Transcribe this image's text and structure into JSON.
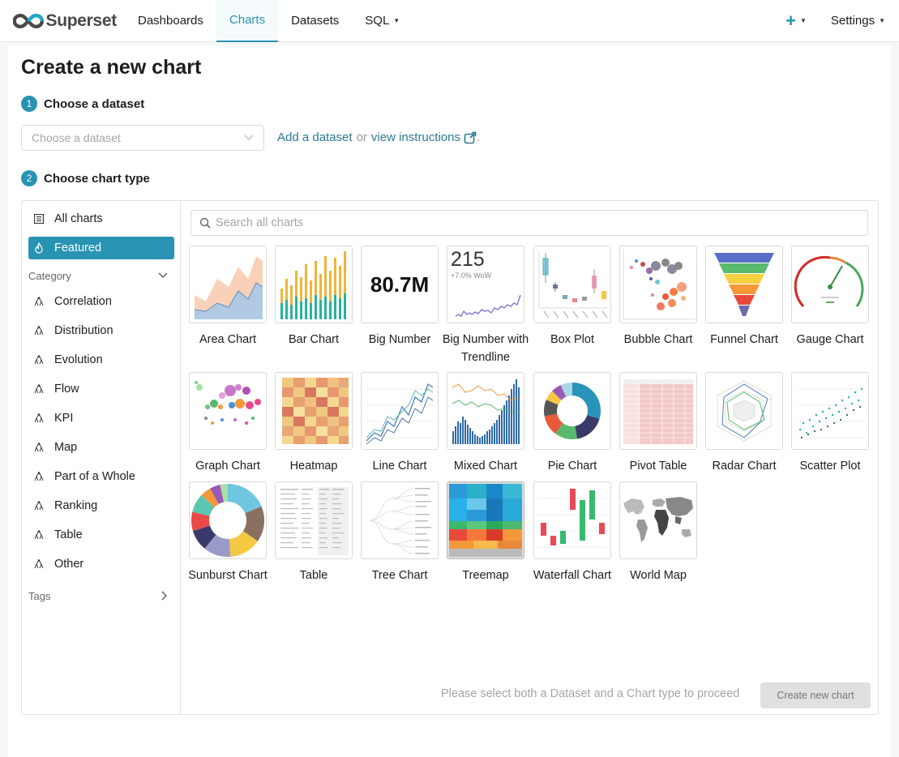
{
  "brand": {
    "name": "Superset",
    "color": "#484848",
    "accent": "#2893b3"
  },
  "nav": {
    "items": [
      {
        "label": "Dashboards"
      },
      {
        "label": "Charts"
      },
      {
        "label": "Datasets"
      },
      {
        "label": "SQL"
      }
    ],
    "active": "Charts",
    "plus_icon": "plus-icon",
    "settings_label": "Settings"
  },
  "page": {
    "title": "Create a new chart"
  },
  "steps": {
    "dataset": {
      "number": "1",
      "label": "Choose a dataset"
    },
    "chart_type": {
      "number": "2",
      "label": "Choose chart type"
    }
  },
  "dataset_select": {
    "placeholder": "Choose a dataset",
    "add_link": "Add a dataset",
    "or_text": "or",
    "instructions_link": "view instructions",
    "period": "."
  },
  "sidebar": {
    "all_charts": "All charts",
    "featured": "Featured",
    "category_header": "Category",
    "categories": [
      "Correlation",
      "Distribution",
      "Evolution",
      "Flow",
      "KPI",
      "Map",
      "Part of a Whole",
      "Ranking",
      "Table",
      "Other"
    ],
    "tags_header": "Tags"
  },
  "search": {
    "placeholder": "Search all charts"
  },
  "charts": [
    {
      "name": "Area Chart"
    },
    {
      "name": "Bar Chart"
    },
    {
      "name": "Big Number",
      "thumb_text": "80.7M"
    },
    {
      "name": "Big Number with Trendline",
      "thumb_value": "215",
      "thumb_sub": "+7.0% WoW"
    },
    {
      "name": "Box Plot"
    },
    {
      "name": "Bubble Chart"
    },
    {
      "name": "Funnel Chart"
    },
    {
      "name": "Gauge Chart"
    },
    {
      "name": "Graph Chart"
    },
    {
      "name": "Heatmap"
    },
    {
      "name": "Line Chart"
    },
    {
      "name": "Mixed Chart"
    },
    {
      "name": "Pie Chart"
    },
    {
      "name": "Pivot Table"
    },
    {
      "name": "Radar Chart"
    },
    {
      "name": "Scatter Plot"
    },
    {
      "name": "Sunburst Chart"
    },
    {
      "name": "Table"
    },
    {
      "name": "Tree Chart"
    },
    {
      "name": "Treemap"
    },
    {
      "name": "Waterfall Chart"
    },
    {
      "name": "World Map"
    }
  ],
  "footer": {
    "message": "Please select both a Dataset and a Chart type to proceed",
    "create_button": "Create new chart"
  }
}
